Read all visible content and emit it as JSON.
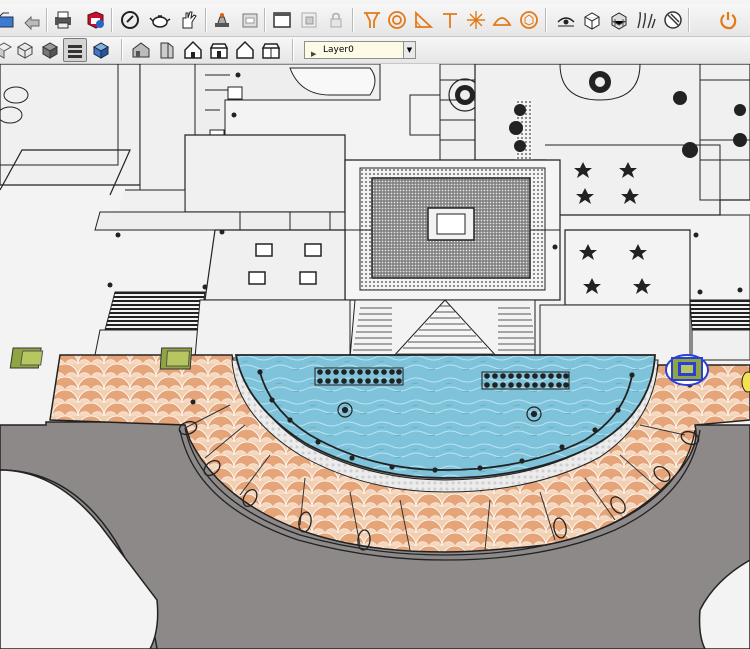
{
  "toolbar_row1": {
    "tools": [
      {
        "id": "open",
        "icon": "open-folder-icon"
      },
      {
        "id": "save",
        "icon": "save-arrow-icon"
      },
      {
        "id": "print",
        "icon": "printer-icon"
      },
      {
        "id": "model-info",
        "icon": "model-info-icon"
      },
      {
        "id": "select-circle",
        "icon": "circle-slash-icon"
      },
      {
        "id": "teapot",
        "icon": "teapot-icon"
      },
      {
        "id": "hand-push",
        "icon": "push-hand-icon"
      },
      {
        "id": "stamp",
        "icon": "stamp-icon"
      },
      {
        "id": "tape",
        "icon": "tape-icon"
      },
      {
        "id": "window",
        "icon": "window-icon"
      },
      {
        "id": "component",
        "icon": "component-icon"
      },
      {
        "id": "lock",
        "icon": "lock-icon"
      },
      {
        "id": "sandbox-from-scratch",
        "icon": "funnel-icon"
      },
      {
        "id": "circle-target",
        "icon": "ring-target-icon"
      },
      {
        "id": "angle",
        "icon": "angle-icon"
      },
      {
        "id": "t-stake",
        "icon": "t-stake-icon"
      },
      {
        "id": "sparkle",
        "icon": "sparkle-icon"
      },
      {
        "id": "dome",
        "icon": "dome-icon"
      },
      {
        "id": "hexagon",
        "icon": "hexagon-icon"
      },
      {
        "id": "sand-eye",
        "icon": "eye-hat-icon"
      },
      {
        "id": "cube-arrow",
        "icon": "cube-arrow-icon"
      },
      {
        "id": "cube-grid",
        "icon": "cube-grid-icon"
      },
      {
        "id": "grass",
        "icon": "grass-icon"
      },
      {
        "id": "no-entry",
        "icon": "no-entry-icon"
      },
      {
        "id": "power",
        "icon": "power-icon"
      }
    ]
  },
  "toolbar_row2": {
    "styles": [
      {
        "id": "xray",
        "icon": "xray-style-icon"
      },
      {
        "id": "wireframe",
        "icon": "wireframe-style-icon"
      },
      {
        "id": "hidden-line",
        "icon": "hidden-line-style-icon"
      },
      {
        "id": "shaded",
        "icon": "shaded-style-icon"
      },
      {
        "id": "shaded-textures",
        "icon": "shaded-textures-style-icon"
      }
    ],
    "views": [
      {
        "id": "iso",
        "icon": "iso-view-icon"
      },
      {
        "id": "top",
        "icon": "top-view-icon"
      },
      {
        "id": "front",
        "icon": "front-view-icon"
      },
      {
        "id": "right",
        "icon": "right-view-icon"
      },
      {
        "id": "back",
        "icon": "back-view-icon"
      },
      {
        "id": "left",
        "icon": "left-view-icon"
      }
    ]
  },
  "layer": {
    "current": "Layer0"
  },
  "colors": {
    "water": "#7fc3db",
    "paving": "#e7ad80",
    "road": "#8d8989",
    "ground": "#f3f3f3",
    "selection": "#2b3fd6",
    "planter": "#8fa541",
    "sandbox_orange": "#e27a17"
  }
}
